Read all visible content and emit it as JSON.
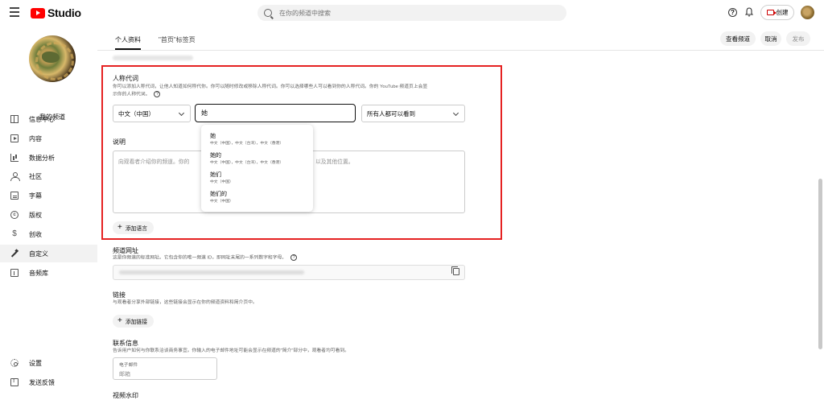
{
  "header": {
    "app_name": "Studio",
    "search_placeholder": "在你的频道中搜索",
    "create_label": "创建"
  },
  "sidebar": {
    "channel_label": "我的频道",
    "items": [
      {
        "label": "信息中心",
        "icon": "dashboard-icon"
      },
      {
        "label": "内容",
        "icon": "content-icon"
      },
      {
        "label": "数据分析",
        "icon": "analytics-icon"
      },
      {
        "label": "社区",
        "icon": "community-icon"
      },
      {
        "label": "字幕",
        "icon": "subtitles-icon"
      },
      {
        "label": "版权",
        "icon": "copyright-icon"
      },
      {
        "label": "创收",
        "icon": "earn-icon"
      },
      {
        "label": "自定义",
        "icon": "customization-icon"
      },
      {
        "label": "音频库",
        "icon": "audio-library-icon"
      }
    ],
    "bottom_items": [
      {
        "label": "设置",
        "icon": "settings-icon"
      },
      {
        "label": "发送反馈",
        "icon": "feedback-icon"
      }
    ],
    "active_item": "自定义"
  },
  "tabs": [
    {
      "label": "个人资料",
      "active": true
    },
    {
      "label": "\"首页\"标签页",
      "active": false
    }
  ],
  "actions": {
    "view_channel": "查看频道",
    "cancel": "取消",
    "publish": "发布"
  },
  "pronouns": {
    "title": "人称代词",
    "description_line1": "你可以添加人称代词，让他人知道如何称代你。你可以随时修改或移除人称代词。你可以选择哪些人可以看到你的人称代词。你的 YouTube 频道页上会显",
    "description_line2": "示你的人称代词。",
    "language_select": "中文（中国）",
    "input_value": "她",
    "visibility_select": "所有人都可以看到",
    "suggestions": [
      {
        "label": "她",
        "sub": "中文（中国），中文（台湾），中文（香港）"
      },
      {
        "label": "她的",
        "sub": "中文（中国），中文（台湾），中文（香港）"
      },
      {
        "label": "她们",
        "sub": "中文（中国）"
      },
      {
        "label": "她们的",
        "sub": "中文（中国）"
      }
    ]
  },
  "description": {
    "title": "说明",
    "placeholder_left": "向观看者介绍你的频道。你的",
    "placeholder_right": "以及其他位置。",
    "add_language": "添加语言"
  },
  "channel_url": {
    "title": "频道网址",
    "description": "这是你频道的标准网址。它包含你的唯一频道 ID，即网址末尾的一系列数字和字母。"
  },
  "links": {
    "title": "链接",
    "description": "与观看者分享外部链接，这些链接会显示在你的频道资料和简介页中。",
    "add_link": "添加链接"
  },
  "contact": {
    "title": "联系信息",
    "description": "告诉用户如何与你联系洽谈商务事宜。你输入的电子邮件地址可能会显示在频道的\"简介\"部分中，观看者均可看到。",
    "email_label": "电子邮件",
    "email_placeholder": "邮箱"
  },
  "watermark": {
    "title": "视频水印"
  },
  "colors": {
    "accent": "#ff0000",
    "highlight_border": "#e52222"
  }
}
